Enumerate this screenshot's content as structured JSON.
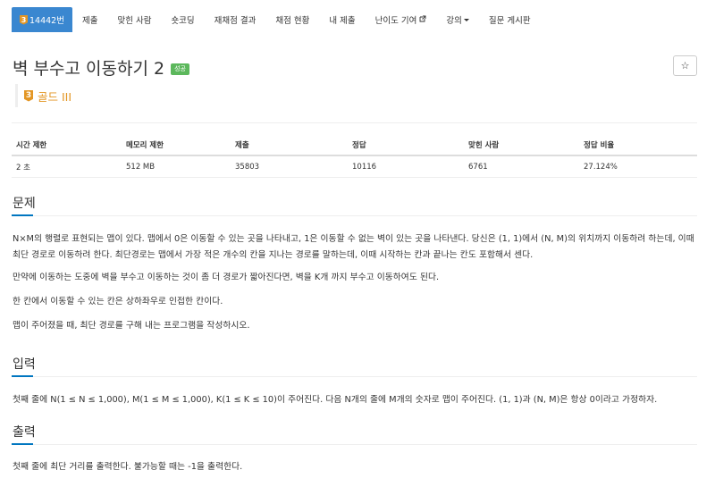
{
  "nav": {
    "problem_tier": "3",
    "problem_id": "14442번",
    "items": [
      "제출",
      "맞힌 사람",
      "숏코딩",
      "재채점 결과",
      "채점 현황",
      "내 제출",
      "난이도 기여",
      "강의",
      "질문 게시판"
    ]
  },
  "problem": {
    "title": "벽 부수고 이동하기 2",
    "result_badge": "성공",
    "star": "☆",
    "tier_num": "3",
    "tier_name": "골드 III"
  },
  "stats": {
    "headers": [
      "시간 제한",
      "메모리 제한",
      "제출",
      "정답",
      "맞힌 사람",
      "정답 비율"
    ],
    "values": [
      "2 초",
      "512 MB",
      "35803",
      "10116",
      "6761",
      "27.124%"
    ]
  },
  "sections": {
    "description": {
      "title": "문제",
      "paragraphs": [
        "N×M의 행렬로 표현되는 맵이 있다. 맵에서 0은 이동할 수 있는 곳을 나타내고, 1은 이동할 수 없는 벽이 있는 곳을 나타낸다. 당신은 (1, 1)에서 (N, M)의 위치까지 이동하려 하는데, 이때 최단 경로로 이동하려 한다. 최단경로는 맵에서 가장 적은 개수의 칸을 지나는 경로를 말하는데, 이때 시작하는 칸과 끝나는 칸도 포함해서 센다.",
        "만약에 이동하는 도중에 벽을 부수고 이동하는 것이 좀 더 경로가 짧아진다면, 벽을 K개 까지 부수고 이동하여도 된다.",
        "한 칸에서 이동할 수 있는 칸은 상하좌우로 인접한 칸이다.",
        "맵이 주어졌을 때, 최단 경로를 구해 내는 프로그램을 작성하시오."
      ]
    },
    "input": {
      "title": "입력",
      "paragraphs": [
        "첫째 줄에 N(1 ≤ N ≤ 1,000), M(1 ≤ M ≤ 1,000), K(1 ≤ K ≤ 10)이 주어진다. 다음 N개의 줄에 M개의 숫자로 맵이 주어진다. (1, 1)과 (N, M)은 항상 0이라고 가정하자."
      ]
    },
    "output": {
      "title": "출력",
      "paragraphs": [
        "첫째 줄에 최단 거리를 출력한다. 불가능할 때는 -1을 출력한다."
      ]
    }
  }
}
